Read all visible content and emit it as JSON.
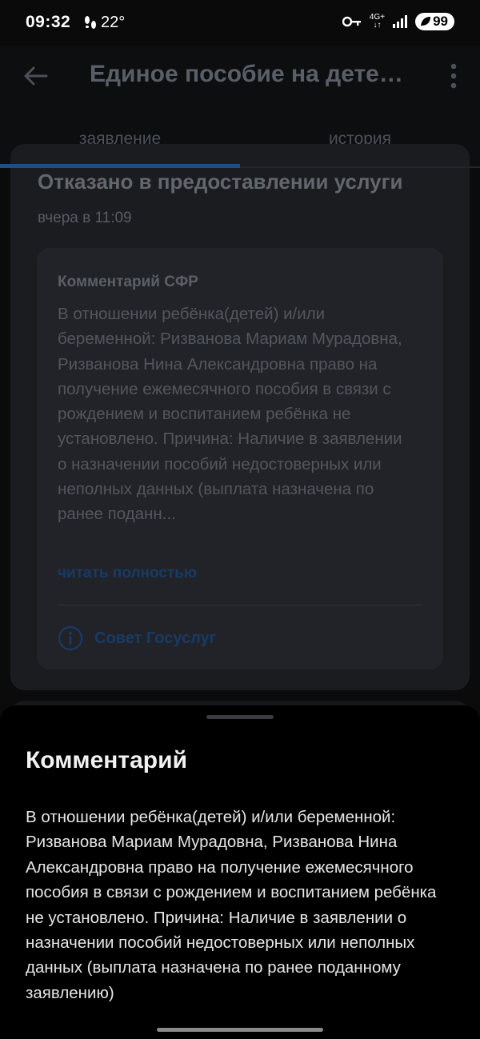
{
  "status_bar": {
    "time": "09:32",
    "temperature": "22°",
    "network": "4G+",
    "battery": "99",
    "icons": [
      "steps-icon",
      "key-icon",
      "signal-icon",
      "leaf-battery-icon"
    ]
  },
  "app_bar": {
    "title": "Единое пособие на детей…",
    "back_icon": "arrow-left-icon",
    "menu_icon": "more-vertical-icon"
  },
  "tabs": [
    {
      "label": "заявление",
      "selected": true
    },
    {
      "label": "история",
      "selected": false
    }
  ],
  "main_card": {
    "status_title": "Отказано в предоставлении услуги",
    "status_time": "вчера в 11:09",
    "comment": {
      "label": "Комментарий СФР",
      "text": "В отношении ребёнка(детей) и/или беременной: Ризванова Мариам Мурадовна, Ризванова Нина Александровна право на получение ежемесячного пособия в связи с рождением и воспитанием ребёнка не установлено. Причина: Наличие в заявлении о назначении пособий недостоверных или неполных данных (выплата назначена по ранее поданн...",
      "read_more": "читать полностью"
    },
    "advice": {
      "icon": "info-icon",
      "label": "Совет Госуслуг"
    }
  },
  "sheet": {
    "title": "Комментарий",
    "text": "В отношении ребёнка(детей) и/или беременной: Ризванова Мариам Мурадовна, Ризванова Нина Александровна право на получение ежемесячного пособия в связи с рождением и воспитанием ребёнка не установлено. Причина: Наличие в заявлении о назначении пособий недостоверных или неполных данных (выплата назначена по ранее поданному заявлению)"
  },
  "colors": {
    "accent": "#1d4f86",
    "link_dimmed": "#173b66",
    "sheet_bg": "#000000",
    "card_bg": "#1b1c20"
  }
}
